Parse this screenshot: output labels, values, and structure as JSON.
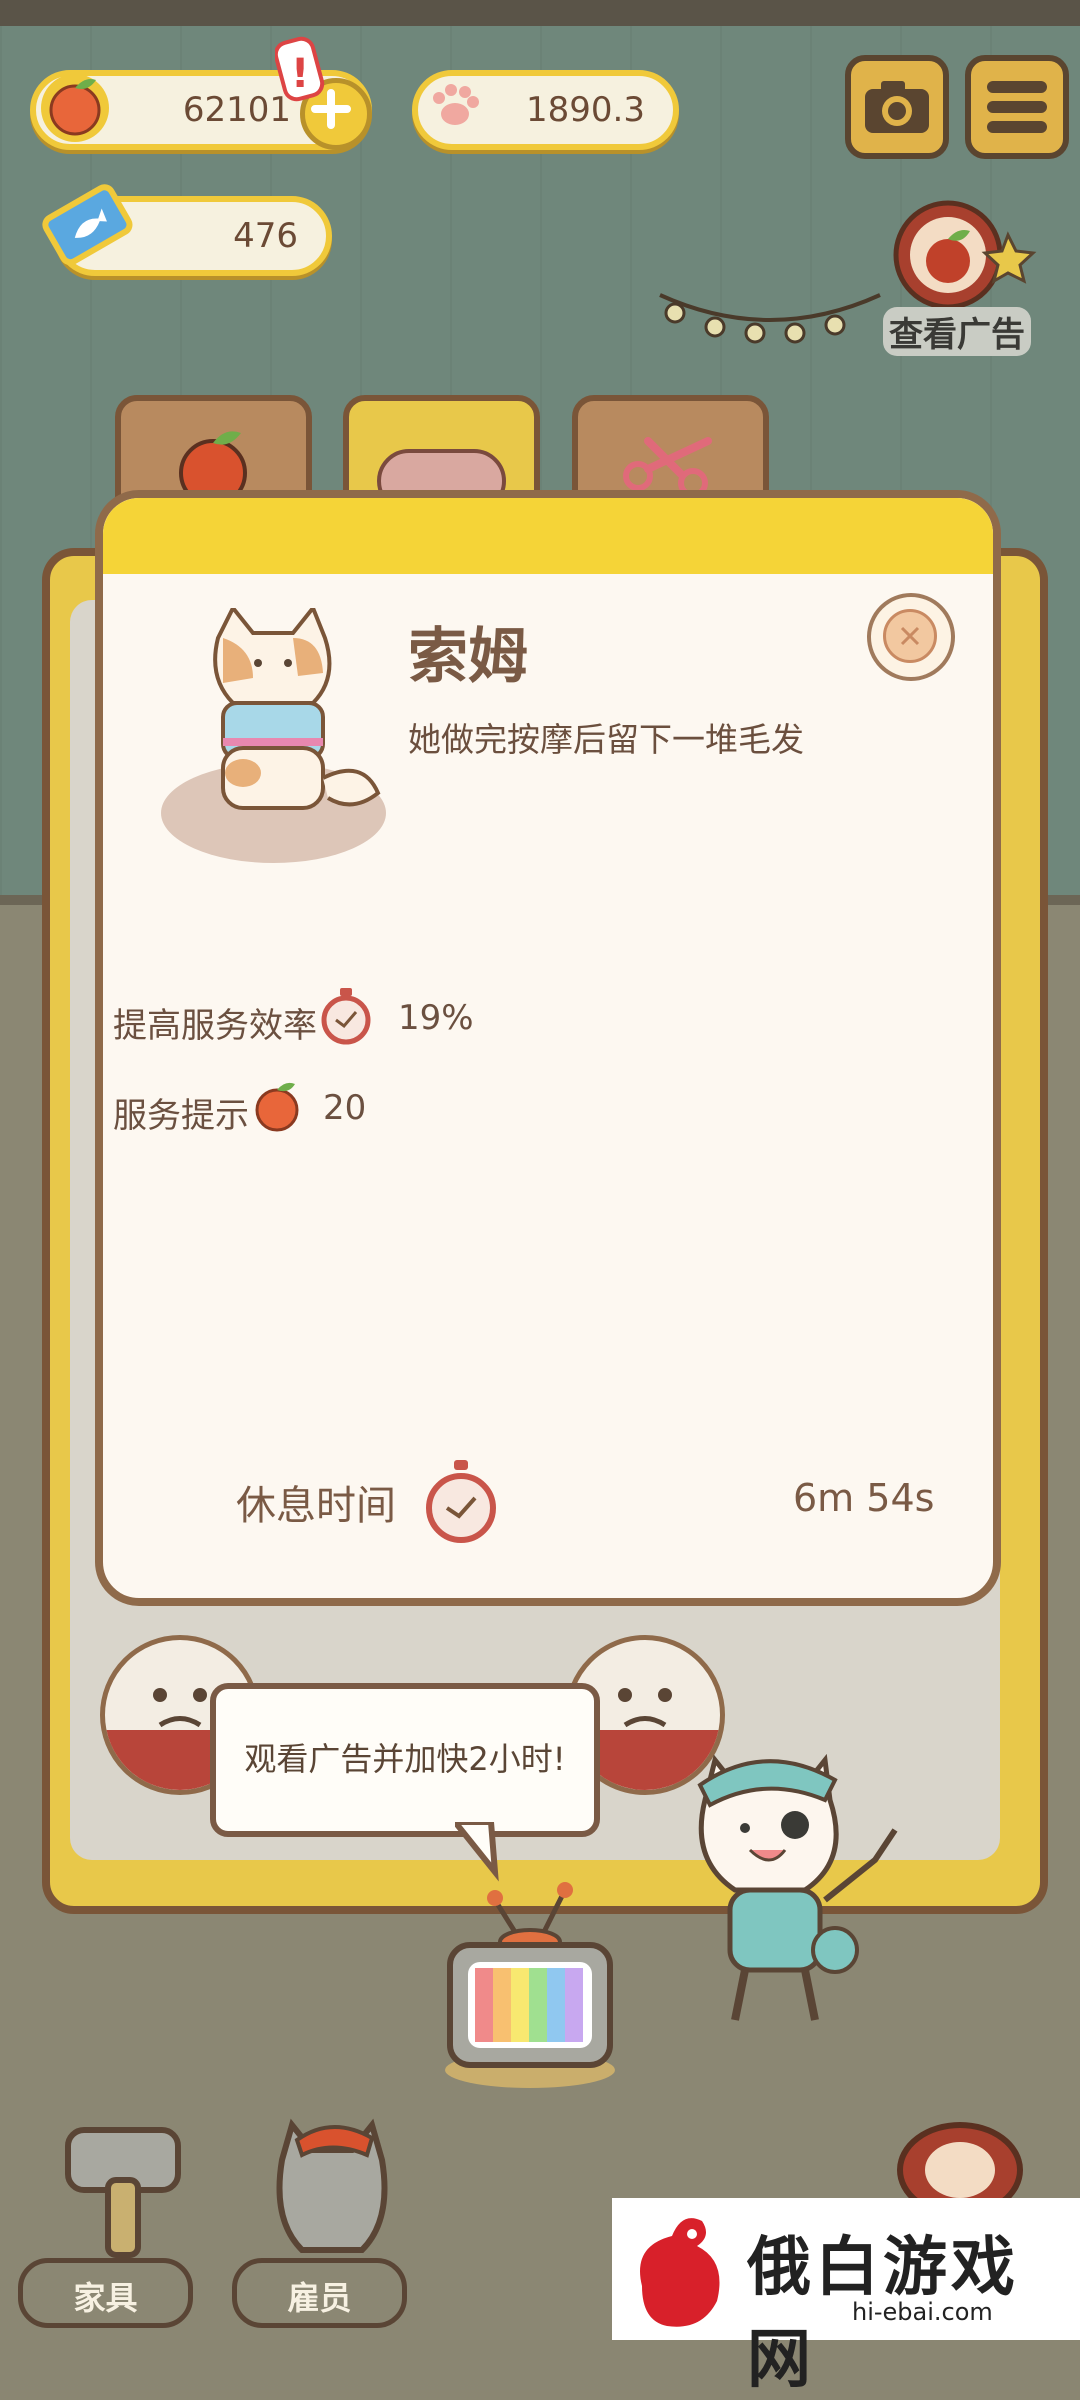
{
  "resources": {
    "apples": "62101",
    "paws": "1890.3",
    "tickets": "476"
  },
  "ad_button": {
    "label": "查看广告"
  },
  "card": {
    "cat_name": "索姆",
    "description": "她做完按摩后留下一堆毛发",
    "stats": [
      {
        "label": "提高服务效率",
        "icon": "stopwatch-icon",
        "value": "19%"
      },
      {
        "label": "服务提示",
        "icon": "apple-icon",
        "value": "20"
      }
    ],
    "rest": {
      "label": "休息时间",
      "value": "6m 54s"
    }
  },
  "tooltip": {
    "text": "观看广告并加快2小时!"
  },
  "nav": {
    "furniture": "家具",
    "staff": "雇员"
  },
  "watermark": {
    "title": "俄白游戏网",
    "url": "hi-ebai.com"
  },
  "colors": {
    "wall": "#6f877b",
    "floor": "#8b8773",
    "accent_yellow": "#f5d437",
    "card_bg": "#fdf8f1",
    "border_brown": "#8f6a4a"
  }
}
